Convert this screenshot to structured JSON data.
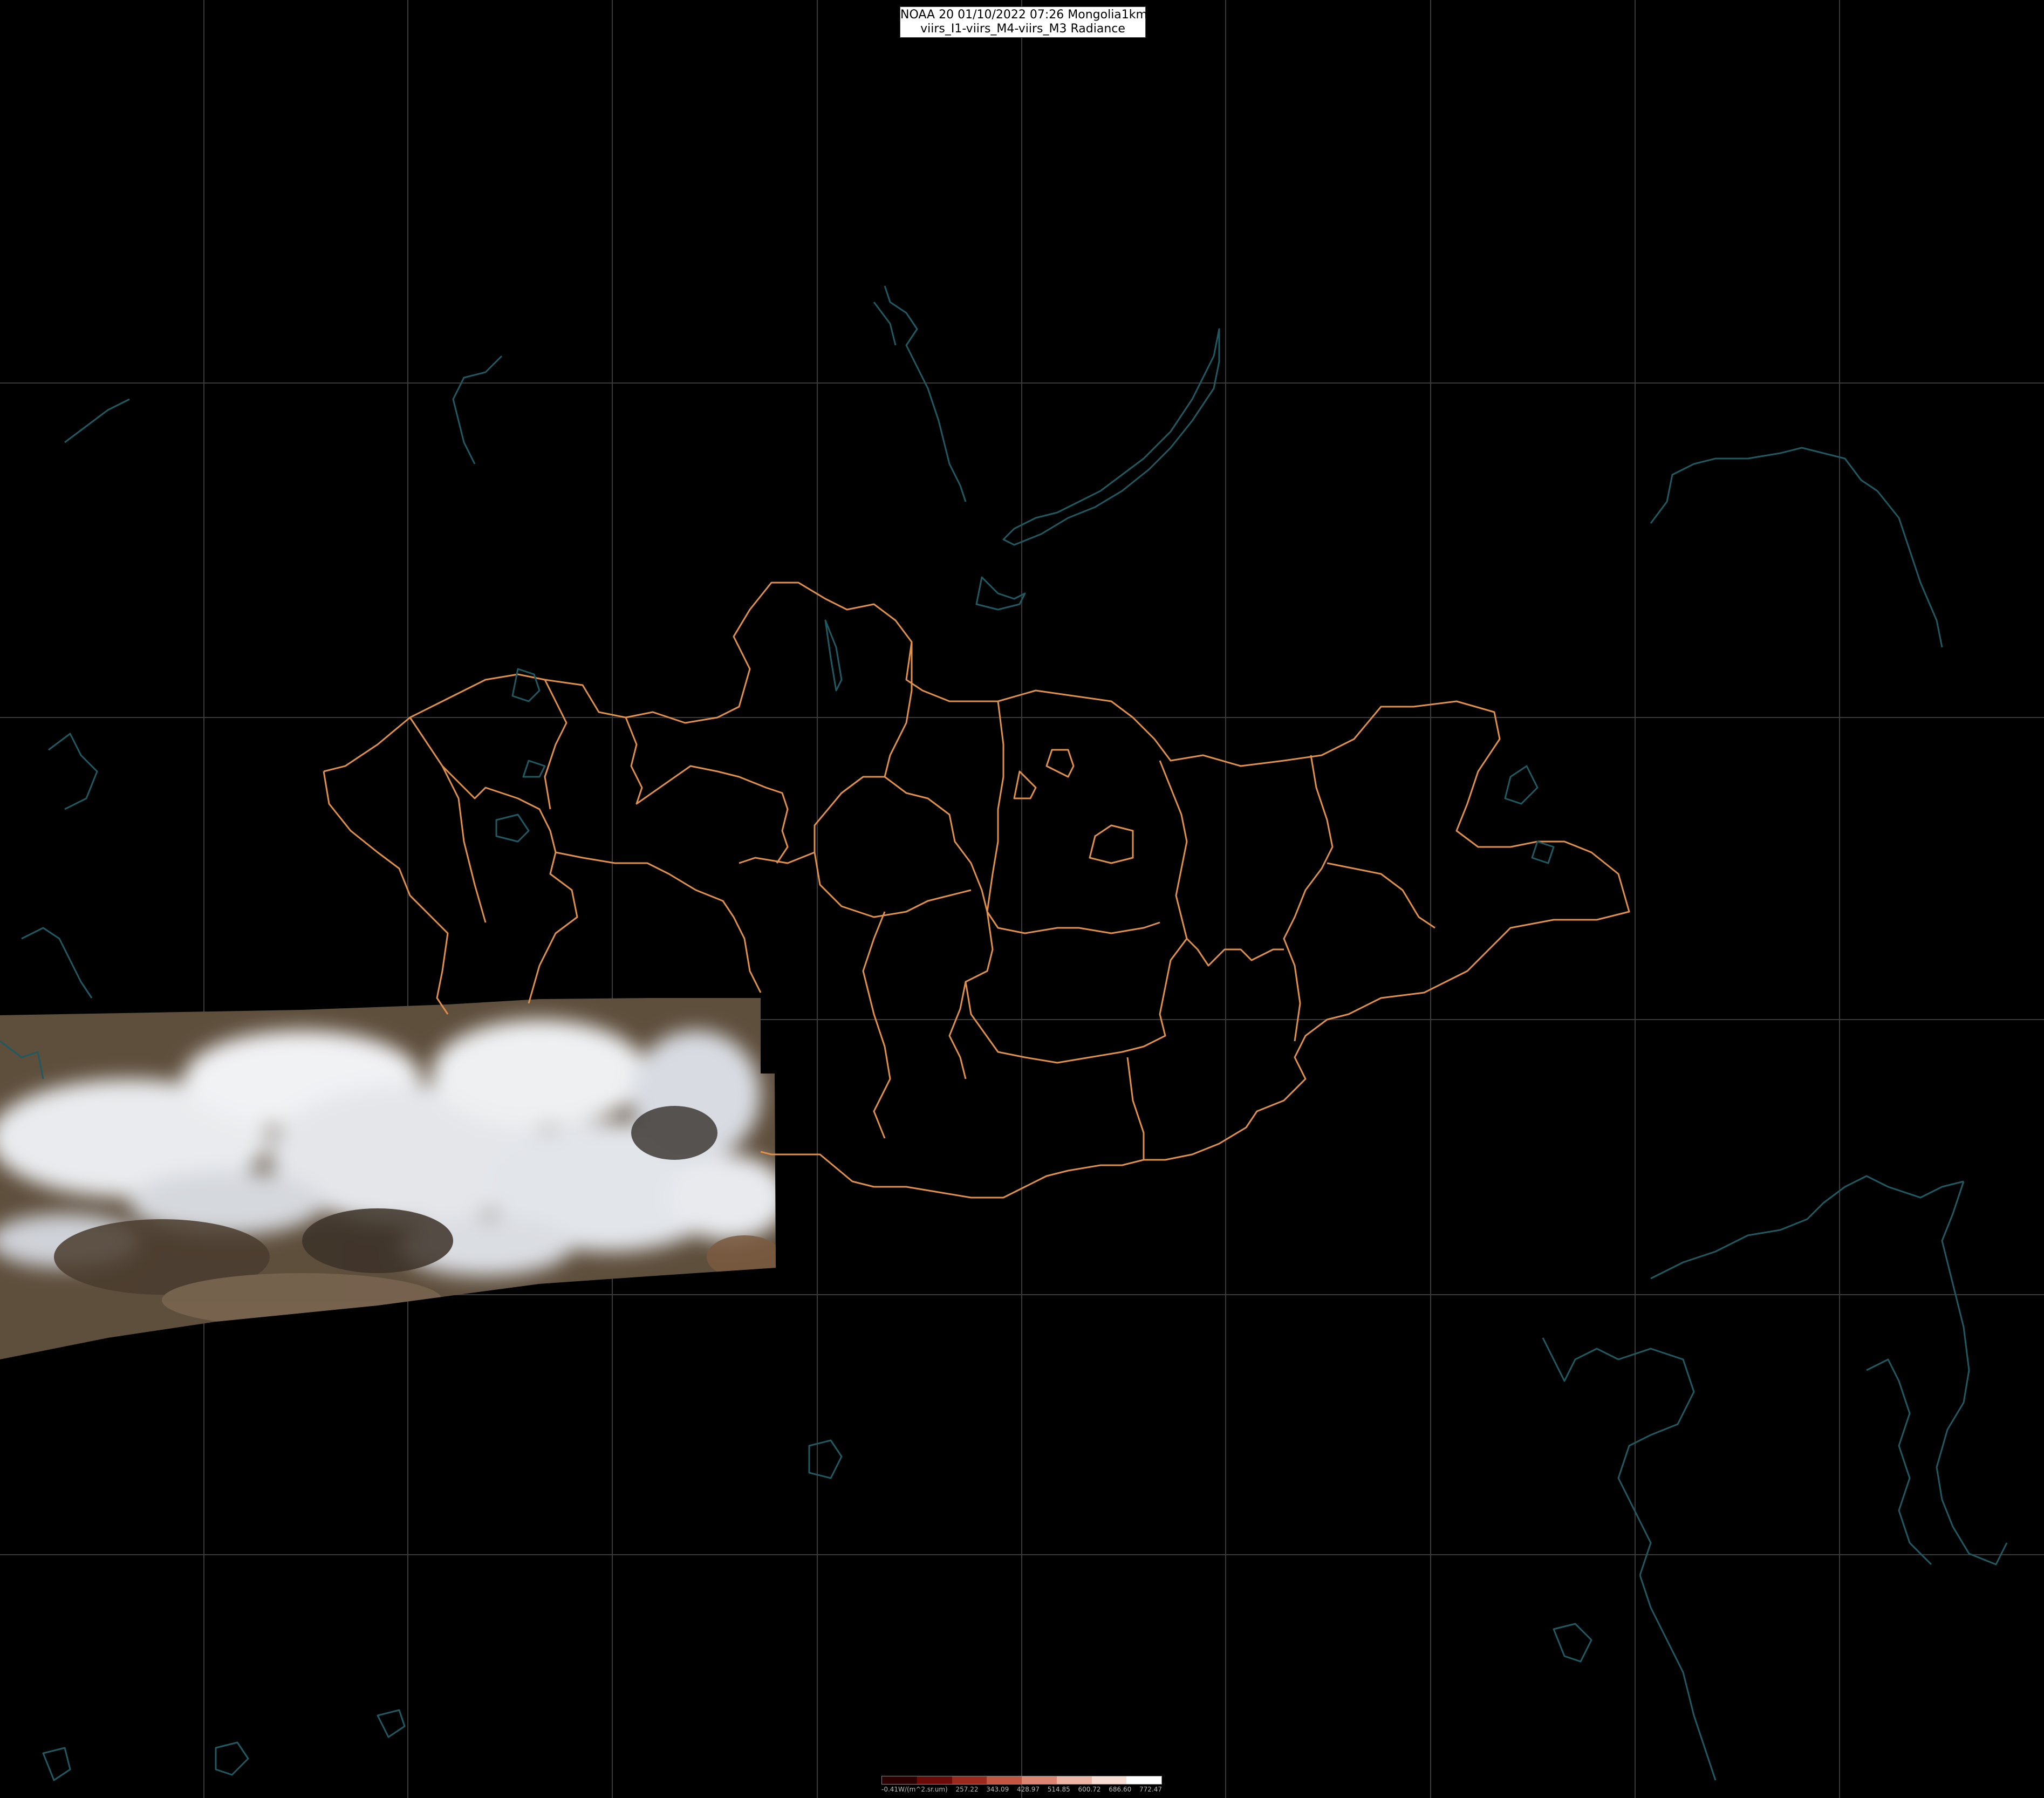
{
  "header": {
    "title_line1": "NOAA 20 01/10/2022 07:26 Mongolia1km",
    "title_line2": "viirs_I1-viirs_M4-viirs_M3 Radiance"
  },
  "legend": {
    "unit_label": "-0.41W/(m^2.sr.um)",
    "ticks": [
      "257.22",
      "343.09",
      "428.97",
      "514.85",
      "600.72",
      "686.60",
      "772.47"
    ],
    "colors": [
      "#2a0000",
      "#6b0a06",
      "#9c2a1c",
      "#c25640",
      "#dc8570",
      "#eeb6a4",
      "#f7ddd2",
      "#ffffff"
    ]
  },
  "map": {
    "background_color": "#000000",
    "graticule_color": "#3a3a3a",
    "border_color": "#e0904a",
    "coast_color": "#1f5a63",
    "imagery_description_colors": {
      "cloud": "#eef0f2",
      "ground": "#6e5a44",
      "dark_terrain": "#3a3026"
    }
  }
}
